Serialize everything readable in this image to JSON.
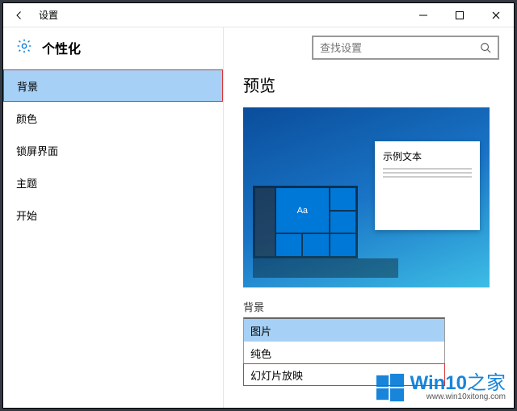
{
  "titlebar": {
    "title": "设置"
  },
  "sidebar": {
    "title": "个性化",
    "items": [
      "背景",
      "颜色",
      "锁屏界面",
      "主题",
      "开始"
    ],
    "selected_index": 0
  },
  "search": {
    "placeholder": "查找设置"
  },
  "main": {
    "preview_heading": "预览",
    "preview_sample_text": "示例文本",
    "preview_tile_text": "Aa",
    "bg_label": "背景",
    "bg_options": [
      "图片",
      "纯色",
      "幻灯片放映"
    ],
    "bg_selected_index": 0,
    "bg_highlight_index": 2
  },
  "watermark": {
    "brand_a": "Win10",
    "brand_b": "之家",
    "url": "www.win10xitong.com"
  },
  "colors": {
    "accent": "#0078d7",
    "selection": "#a6d0f5",
    "highlight_border": "#d33"
  }
}
